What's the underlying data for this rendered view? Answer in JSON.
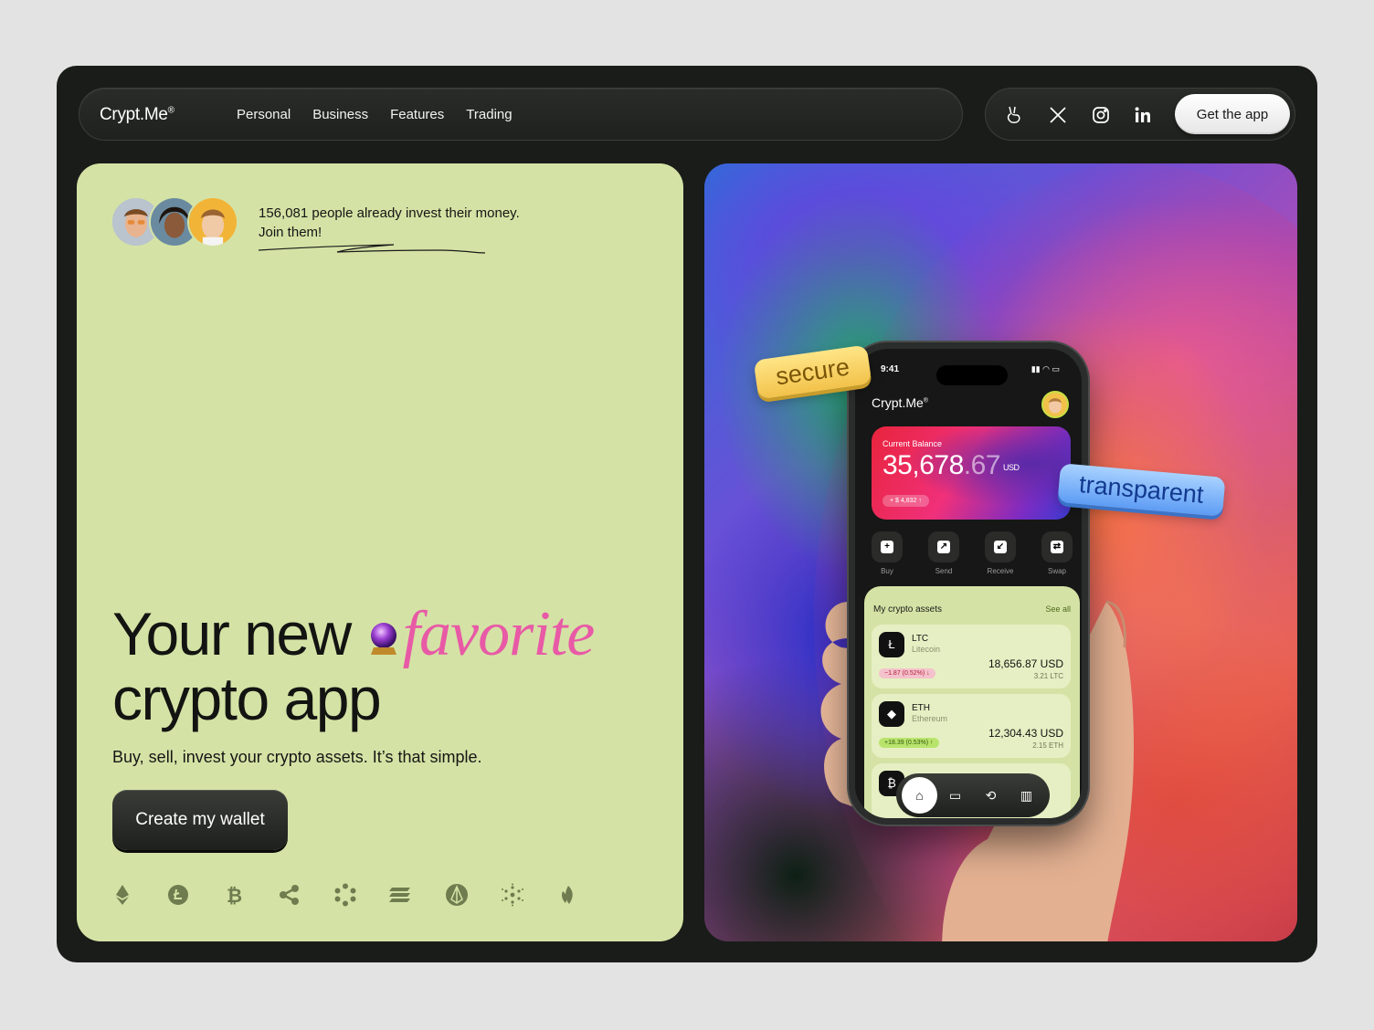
{
  "nav": {
    "logo": "Crypt.Me",
    "logo_mark": "®",
    "links": [
      "Personal",
      "Business",
      "Features",
      "Trading"
    ],
    "socials": [
      "peace-icon",
      "x-icon",
      "instagram-icon",
      "linkedin-icon"
    ],
    "cta": "Get the app"
  },
  "hero": {
    "proof_line1": "156,081 people already invest their money.",
    "proof_line2": "Join them!",
    "headline_start": "Your new",
    "headline_accent": "favorite",
    "headline_end": "crypto app",
    "subtitle": "Buy, sell, invest your crypto assets. It’s that simple.",
    "cta": "Create my wallet",
    "coins": [
      "ethereum-icon",
      "litecoin-icon",
      "bitcoin-icon",
      "ripple-icon",
      "polkadot-icon",
      "solana-icon",
      "eos-icon",
      "cardano-icon",
      "bnb-icon"
    ]
  },
  "tags": {
    "secure": "secure",
    "transparent": "transparent"
  },
  "phone": {
    "time": "9:41",
    "app_name": "Crypt.Me",
    "app_mark": "®",
    "balance_label": "Current Balance",
    "balance_int": "35,678",
    "balance_dec": ".67",
    "balance_currency": "USD",
    "balance_change": "+ $ 4,832 ↑",
    "actions": [
      "Buy",
      "Send",
      "Receive",
      "Swap"
    ],
    "assets_title": "My crypto assets",
    "see_all": "See all",
    "assets": [
      {
        "symbol": "LTC",
        "name": "Litecoin",
        "usd": "18,656.87 USD",
        "qty": "3.21 LTC",
        "change": "−1.87 (0.52%) ↓"
      },
      {
        "symbol": "ETH",
        "name": "Ethereum",
        "usd": "12,304.43 USD",
        "qty": "2.15 ETH",
        "change": "+18.39 (0.53%) ↑"
      }
    ]
  },
  "colors": {
    "accent_pink": "#e85aa6",
    "card_green": "#d4e3a5",
    "frame_dark": "#1a1c19"
  }
}
